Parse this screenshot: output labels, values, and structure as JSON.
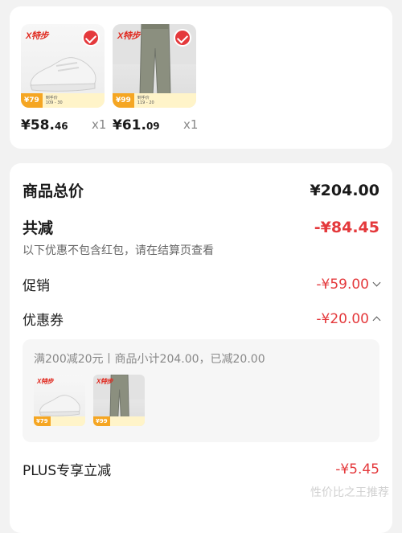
{
  "products": [
    {
      "price_main": "¥58.",
      "price_cents": "46",
      "qty": "x1",
      "badge_price": "79",
      "brand": "X特步",
      "strip_line1": "到手价",
      "strip_line2": "109 - 30"
    },
    {
      "price_main": "¥61.",
      "price_cents": "09",
      "qty": "x1",
      "badge_price": "99",
      "brand": "X特步",
      "strip_line1": "到手价",
      "strip_line2": "119 - 20"
    }
  ],
  "summary": {
    "total_label": "商品总价",
    "total_value": "¥204.00",
    "reduce_label": "共减",
    "reduce_value": "-¥84.45",
    "note": "以下优惠不包含红包，请在结算页查看",
    "promo_label": "促销",
    "promo_value": "-¥59.00",
    "coupon_label": "优惠券",
    "coupon_value": "-¥20.00",
    "coupon_detail": "满200减20元丨商品小计204.00，已减20.00",
    "coupon_items": [
      {
        "badge_price": "79",
        "brand": "X特步"
      },
      {
        "badge_price": "99",
        "brand": "X特步"
      }
    ],
    "plus_label": "PLUS专享立减",
    "plus_value": "-¥5.45"
  },
  "watermark": "性价比之王推荐",
  "colors": {
    "accent_red": "#e4393c",
    "background": "#f2f2f2",
    "card": "#ffffff"
  }
}
